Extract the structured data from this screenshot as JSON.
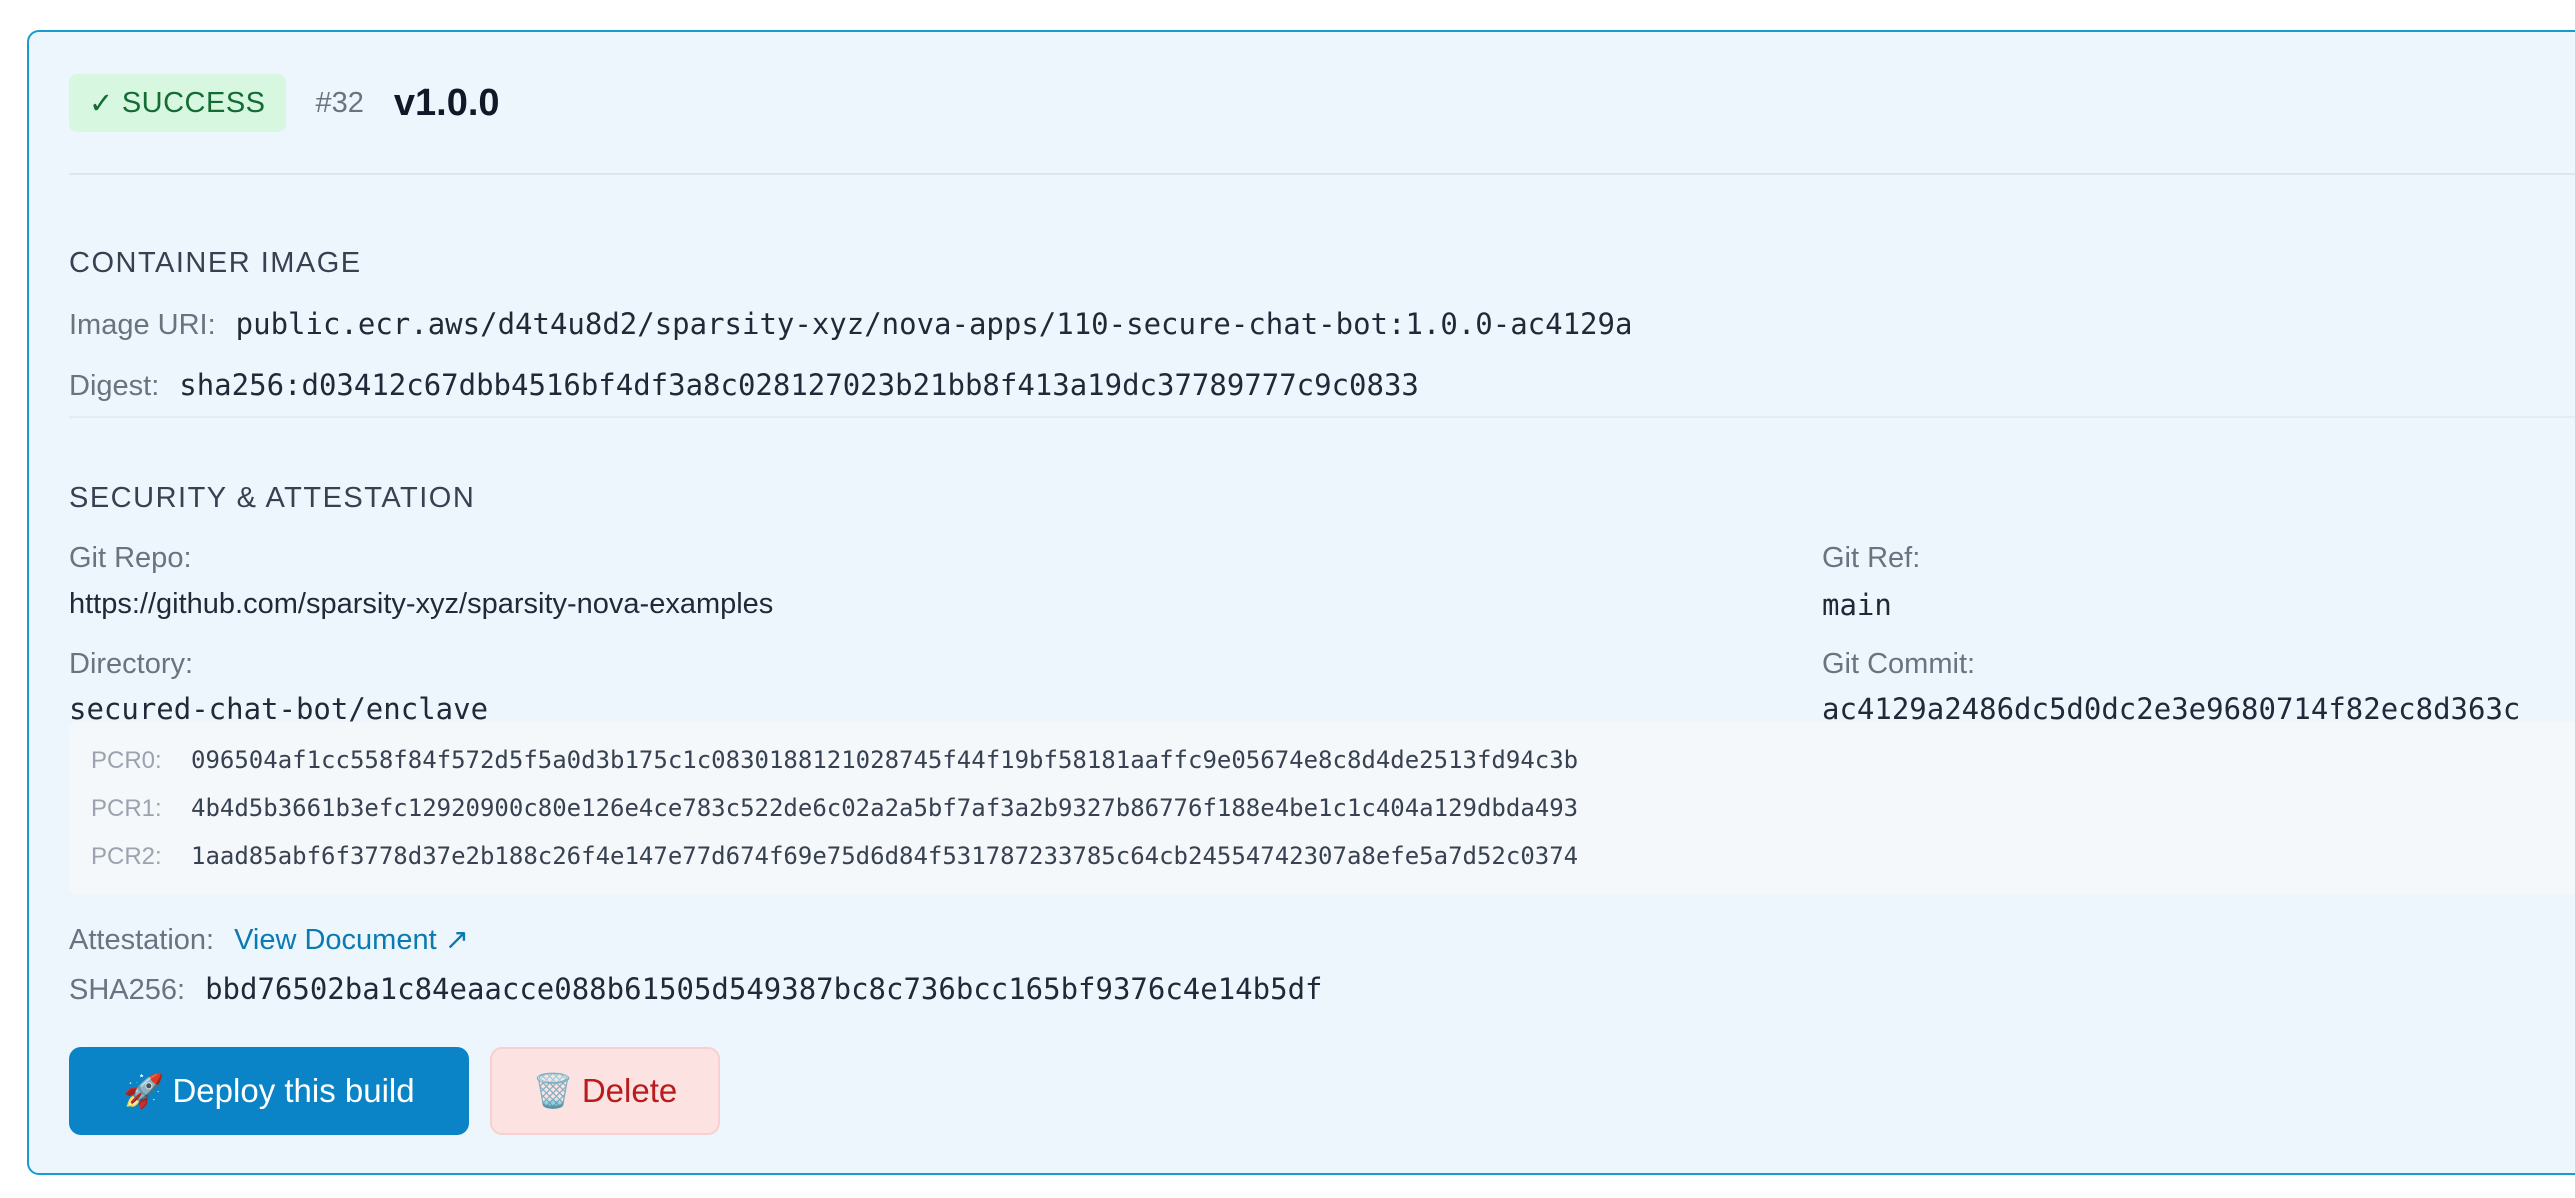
{
  "header": {
    "status_check": "✓",
    "status_label": "SUCCESS",
    "build_number": "#32",
    "version": "v1.0.0"
  },
  "container_image": {
    "title": "CONTAINER IMAGE",
    "image_uri_label": "Image URI:",
    "image_uri": "public.ecr.aws/d4t4u8d2/sparsity-xyz/nova-apps/110-secure-chat-bot:1.0.0-ac4129a",
    "digest_label": "Digest:",
    "digest": "sha256:d03412c67dbb4516bf4df3a8c028127023b21bb8f413a19dc37789777c9c0833"
  },
  "security": {
    "title": "SECURITY & ATTESTATION",
    "git_repo_label": "Git Repo:",
    "git_repo": "https://github.com/sparsity-xyz/sparsity-nova-examples",
    "git_ref_label": "Git Ref:",
    "git_ref": "main",
    "directory_label": "Directory:",
    "directory": "secured-chat-bot/enclave",
    "git_commit_label": "Git Commit:",
    "git_commit": "ac4129a2486dc5d0dc2e3e9680714f82ec8d363c",
    "pcrs": [
      {
        "label": "PCR0:",
        "value": "096504af1cc558f84f572d5f5a0d3b175c1c0830188121028745f44f19bf58181aaffc9e05674e8c8d4de2513fd94c3b"
      },
      {
        "label": "PCR1:",
        "value": "4b4d5b3661b3efc12920900c80e126e4ce783c522de6c02a2a5bf7af3a2b9327b86776f188e4be1c1c404a129dbda493"
      },
      {
        "label": "PCR2:",
        "value": "1aad85abf6f3778d37e2b188c26f4e147e77d674f69e75d6d84f531787233785c64cb24554742307a8efe5a7d52c0374"
      }
    ],
    "attestation_label": "Attestation:",
    "attestation_link": "View Document ↗",
    "sha256_label": "SHA256:",
    "sha256": "bbd76502ba1c84eaacce088b61505d549387bc8c736bcc165bf9376c4e14b5df"
  },
  "actions": {
    "deploy_icon": "🚀",
    "deploy_label": "Deploy this build",
    "delete_icon": "🗑️",
    "delete_label": "Delete"
  }
}
